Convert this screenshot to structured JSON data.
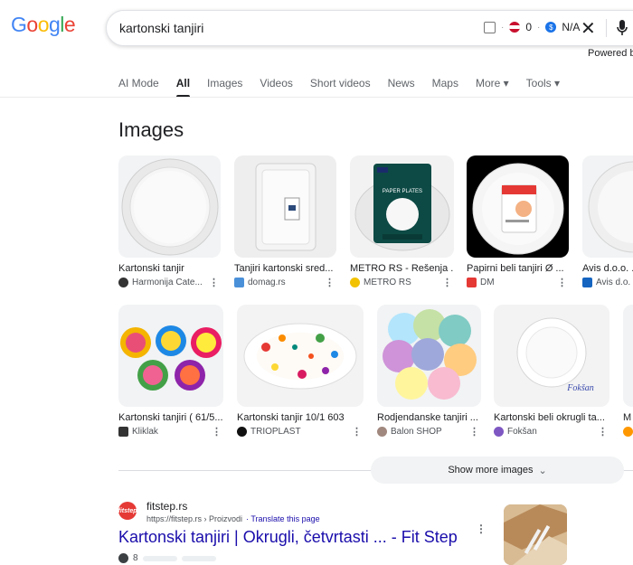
{
  "logo": [
    "G",
    "o",
    "o",
    "g",
    "l",
    "e"
  ],
  "search": {
    "query": "kartonski tanjiri",
    "ext_count": "0",
    "ext_value": "N/A",
    "powered_by": "Powered by"
  },
  "tabs": [
    {
      "label": "AI Mode"
    },
    {
      "label": "All",
      "active": true
    },
    {
      "label": "Images"
    },
    {
      "label": "Videos"
    },
    {
      "label": "Short videos"
    },
    {
      "label": "News"
    },
    {
      "label": "Maps"
    },
    {
      "label": "More ▾"
    },
    {
      "label": "Tools ▾"
    }
  ],
  "images_section": {
    "heading": "Images",
    "row1": [
      {
        "title": "Kartonski tanjir",
        "source": "Harmonija Cate...",
        "fav_color": "#333333"
      },
      {
        "title": "Tanjiri kartonski sred...",
        "source": "domag.rs",
        "fav_color": "#4a90d9"
      },
      {
        "title": "METRO RS - Rešenja ...",
        "source": "METRO RS",
        "fav_color": "#f2c200"
      },
      {
        "title": "Papirni beli tanjiri Ø ...",
        "source": "DM",
        "fav_color": "#e53935"
      },
      {
        "title": "Avis d.o.o. ...",
        "source": "Avis d.o.",
        "fav_color": "#1565c0"
      }
    ],
    "row2": [
      {
        "title": "Kartonski tanjiri ( 61/5...",
        "source": "Kliklak",
        "fav_color": "#333333"
      },
      {
        "title": "Kartonski tanjir 10/1 603",
        "source": "TRIOPLAST",
        "fav_color": "#111111"
      },
      {
        "title": "Rodjendanske tanjiri ...",
        "source": "Balon SHOP",
        "fav_color": "#a1887f"
      },
      {
        "title": "Kartonski beli okrugli ta...",
        "source": "Fokšan",
        "fav_color": "#7e57c2"
      },
      {
        "title": "M",
        "source": "",
        "fav_color": "#ff9800"
      }
    ],
    "show_more": "Show more images",
    "foksan_mark": "Fokšan",
    "metro_label": "PAPER PLATES"
  },
  "result": {
    "favicon_text": "fitstep",
    "site": "fitstep.rs",
    "url": "https://fitstep.rs › Proizvodi",
    "translate": "· Translate this page",
    "title": "Kartonski tanjiri | Okrugli, četvrtasti ... - Fit Step",
    "rating": "8"
  },
  "colors": {
    "link": "#1a0dab",
    "accent": "#1a73e8"
  }
}
